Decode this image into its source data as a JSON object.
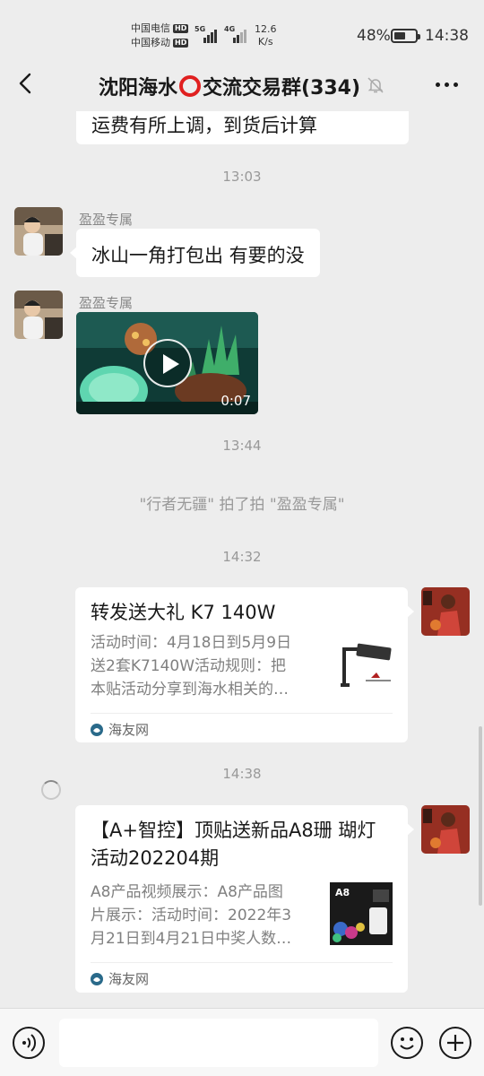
{
  "status_bar": {
    "carrier1": "中国电信",
    "carrier2": "中国移动",
    "hd": "HD",
    "net1": "5G",
    "net2": "4G",
    "speed_value": "12.6",
    "speed_unit": "K/s",
    "battery_percent": "48%",
    "battery_level": 0.48,
    "time": "14:38"
  },
  "header": {
    "title_part1": "沈阳海水",
    "title_part2": "交流交易群(334)",
    "back_icon": "chevron-left-icon",
    "mute_icon": "bell-off-icon",
    "more_icon": "more-dots-icon"
  },
  "messages": {
    "partial_text": "运费有所上调，到货后计算",
    "time1": "13:03",
    "sender1": "盈盈专属",
    "text1": "冰山一角打包出 有要的没",
    "sender2": "盈盈专属",
    "video_duration": "0:07",
    "time2": "13:44",
    "system_pat": "\"行者无疆\" 拍了拍 \"盈盈专属\"",
    "time3": "14:32",
    "card1": {
      "title": "转发送大礼 K7 140W",
      "desc_line1": "活动时间：4月18日到5月9日",
      "desc_line2": "送2套K7140W活动规则：把",
      "desc_line3": "本贴活动分享到海水相关的…",
      "source": "海友网"
    },
    "time4": "14:38",
    "card2": {
      "title_line1": "【A+智控】顶贴送新品A8珊 瑚灯",
      "title_line2": "活动202204期",
      "desc_line1": "A8产品视频展示：A8产品图",
      "desc_line2": "片展示：活动时间：2022年3",
      "desc_line3": "月21日到4月21日中奖人数…",
      "thumb_label": "A8",
      "source": "海友网"
    }
  },
  "input_bar": {
    "placeholder": "",
    "voice_icon": "voice-icon",
    "emoji_icon": "emoji-icon",
    "plus_icon": "plus-icon"
  }
}
